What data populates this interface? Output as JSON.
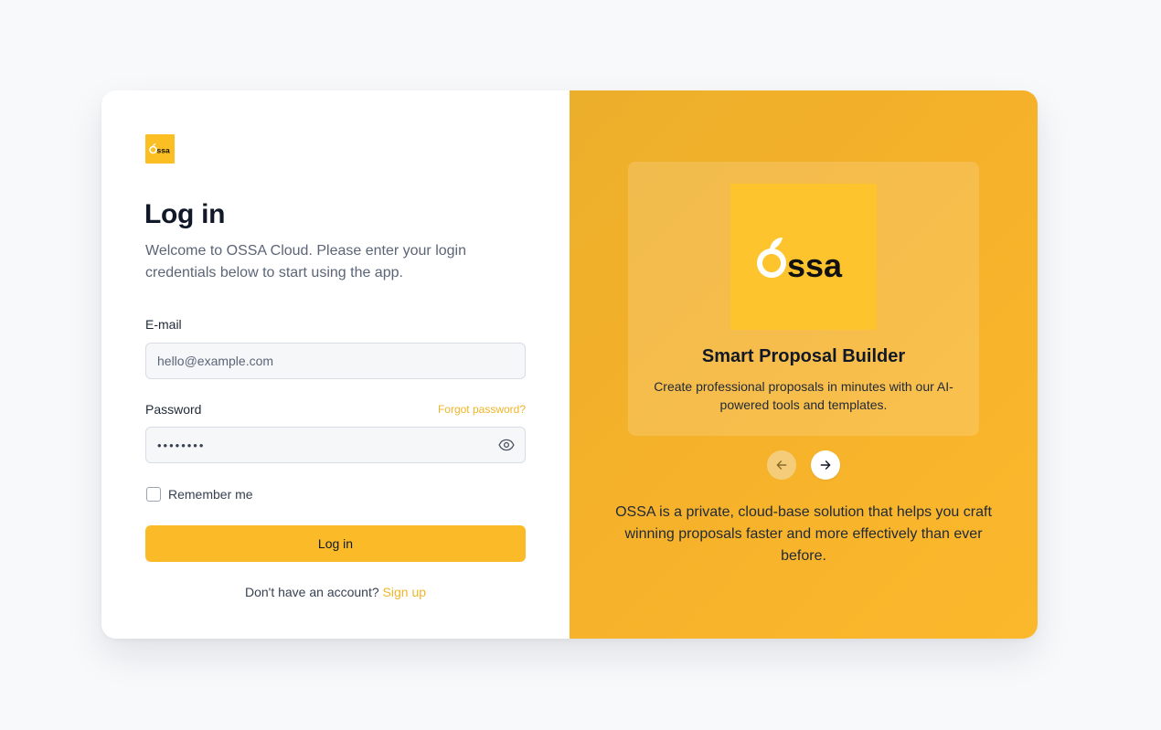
{
  "brand": {
    "logo_text": "ssa",
    "logo_initial": "O",
    "accent_color": "#fbbb29",
    "link_color": "#f0b428"
  },
  "login": {
    "title": "Log in",
    "subtitle": "Welcome to OSSA Cloud. Please enter your login credentials below to start using the app.",
    "email_label": "E-mail",
    "email_placeholder": "hello@example.com",
    "password_label": "Password",
    "password_value": "••••••••",
    "forgot_label": "Forgot password?",
    "remember_label": "Remember me",
    "remember_checked": false,
    "submit_label": "Log in",
    "signup_prompt": "Don't have an account?",
    "signup_label": "Sign up"
  },
  "showcase": {
    "slide_title": "Smart Proposal Builder",
    "slide_description": "Create professional proposals in minutes with our AI-powered tools and templates.",
    "prev_icon": "arrow-left-icon",
    "next_icon": "arrow-right-icon",
    "tagline": "OSSA is a private, cloud-base solution that helps you craft winning proposals faster and more effectively than ever before."
  }
}
